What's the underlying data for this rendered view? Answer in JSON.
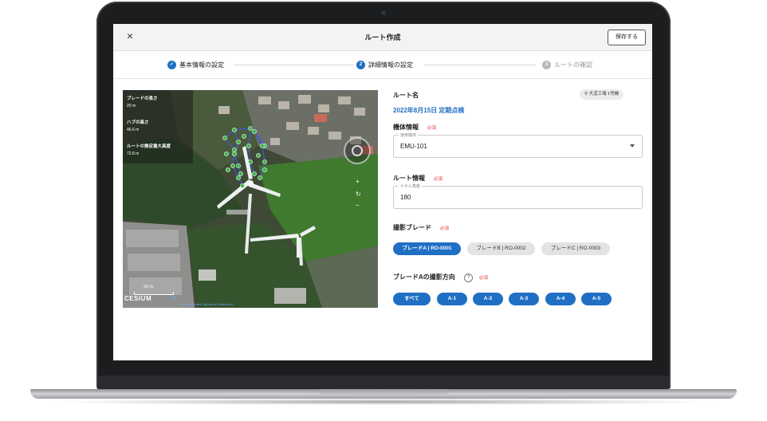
{
  "header": {
    "close_icon": "×",
    "title": "ルート作成",
    "save_label": "保存する"
  },
  "stepper": {
    "steps": [
      {
        "number": "✓",
        "label": "基本情報の設定",
        "state": "done"
      },
      {
        "number": "2",
        "label": "詳細情報の設定",
        "state": "active"
      },
      {
        "number": "3",
        "label": "ルートの確認",
        "state": "pending"
      }
    ]
  },
  "map": {
    "stats": [
      {
        "label": "ブレードの長さ",
        "value": "20 m"
      },
      {
        "label": "ハブの高さ",
        "value": "46.6 m"
      },
      {
        "label": "ルートの推定最大高度",
        "value": "72.8 m"
      }
    ],
    "zoom_in": "+",
    "reset": "↻",
    "zoom_out": "−",
    "scale_label": "20 m",
    "cesium_logo": "CESIUM",
    "cesium_ion": "ion",
    "attribution": "Data attribution  Upload to Cesium ion"
  },
  "form": {
    "route_name_label": "ルート名",
    "turbine_chip": "大沼工場 1号機",
    "route_name_value": "2022年8月15日 定期点検",
    "aircraft_label": "機体情報",
    "required": "必須",
    "aircraft_field_legend": "使用機体",
    "aircraft_value": "EMU-101",
    "route_info_label": "ルート情報",
    "nacelle_legend": "ナセル角度",
    "nacelle_value": "180",
    "blade_label": "撮影ブレード",
    "blades": [
      {
        "label": "ブレードA | RO-0001",
        "selected": true
      },
      {
        "label": "ブレードB | RO-0002",
        "selected": false
      },
      {
        "label": "ブレードC | RO-0003",
        "selected": false
      }
    ],
    "direction_label": "ブレードAの撮影方向",
    "help": "?",
    "directions": [
      {
        "label": "すべて"
      },
      {
        "label": "A-1"
      },
      {
        "label": "A-2"
      },
      {
        "label": "A-3"
      },
      {
        "label": "A-4"
      },
      {
        "label": "A-5"
      }
    ]
  },
  "colors": {
    "accent": "#1f6fc4",
    "required": "#e53935"
  }
}
